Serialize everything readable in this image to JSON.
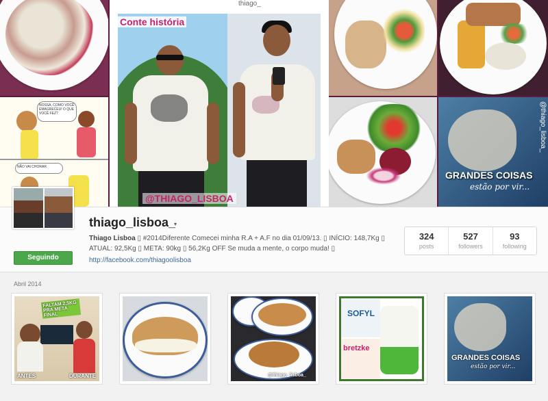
{
  "collage": {
    "featured_title": "Conte história",
    "featured_watermark": "@THIAGO_LISBOA",
    "top_username": "thiago_",
    "comic_text_1": "NOSSA, COMO VOCÊ EMAGRECEU! O QUE VOCÊ FEZ?",
    "comic_text_2": "NÃO VAI CHORAR",
    "lion_title": "GRANDES COISAS",
    "lion_subtitle": "estão por vir...",
    "lion_handle": "@thiago_lisboa_"
  },
  "profile": {
    "username": "thiago_lisboa_",
    "caret": "▾",
    "follow_button": "Seguindo",
    "bio_name": "Thiago Lisboa",
    "bio_text": " ▯ #2014Diferente Comecei minha R.A + A.F no dia 01/09/13. ▯ INÍCIO: 148,7Kg ▯ ATUAL: 92,5Kg ▯ META: 90kg ▯ 56,2Kg OFF Se muda a mente, o corpo muda! ▯",
    "link": "http://facebook.com/thiagoolisboa",
    "stats": [
      {
        "num": "324",
        "label": "posts"
      },
      {
        "num": "527",
        "label": "followers"
      },
      {
        "num": "93",
        "label": "following"
      }
    ]
  },
  "grid": {
    "date_label": "Abril 2014",
    "thumb1_top": "FALTAM 2,5KG PRA META FINAL",
    "thumb1_antes": "ANTES",
    "thumb1_durante": "DURANTE",
    "thumb3_handle": "@thiago_lisboa_",
    "thumb4_brand": "SOFYL",
    "thumb4_brand2": "bretzke",
    "thumb5_title": "GRANDES COISAS",
    "thumb5_sub": "estão por vir..."
  },
  "colors": {
    "follow_green": "#4aa84a",
    "link_blue": "#3c6a94",
    "magenta": "#c9206a"
  }
}
